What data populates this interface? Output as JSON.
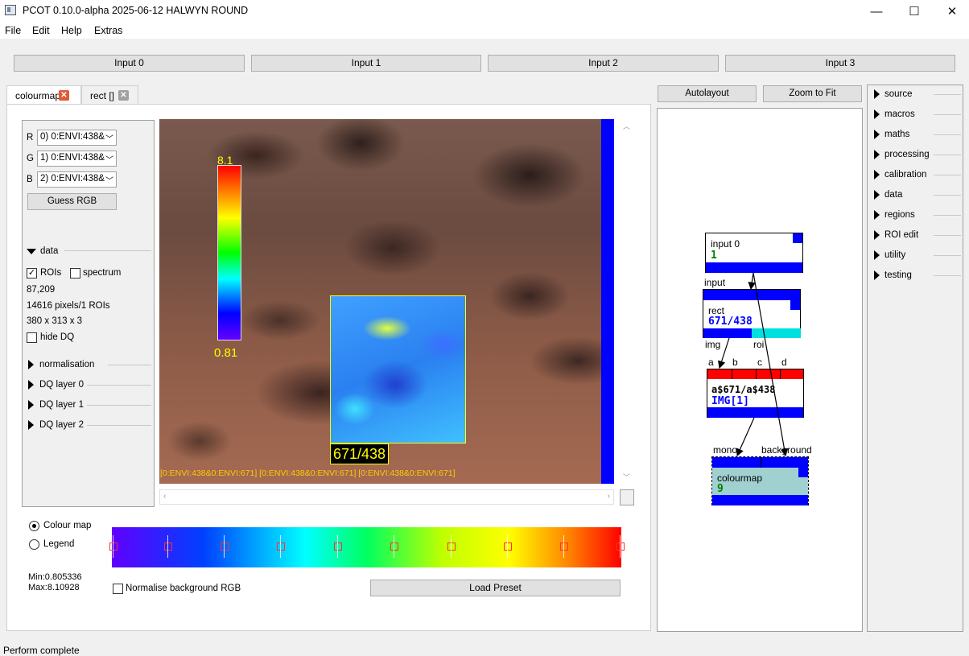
{
  "window": {
    "title": "PCOT 0.10.0-alpha 2025-06-12 HALWYN ROUND",
    "minimize": "—",
    "maximize": "☐",
    "close": "✕"
  },
  "menu": [
    "File",
    "Edit",
    "Help",
    "Extras"
  ],
  "inputs": [
    "Input 0",
    "Input 1",
    "Input 2",
    "Input 3"
  ],
  "tabs": [
    {
      "label": "colourmap",
      "active": true,
      "close_color": "#e05a3a"
    },
    {
      "label": "rect []",
      "active": false,
      "close_color": "#a0a0a0"
    }
  ],
  "controls": {
    "r_label": "R",
    "g_label": "G",
    "b_label": "B",
    "r_value": "0) 0:ENVI:438&",
    "g_value": "1) 0:ENVI:438&",
    "b_value": "2) 0:ENVI:438&",
    "guess_rgb": "Guess RGB",
    "data_section": "data",
    "rois_label": "ROIs",
    "rois_checked": true,
    "spectrum_label": "spectrum",
    "spectrum_checked": false,
    "coords": "87,209",
    "pixels": "14616 pixels/1 ROIs",
    "dims": "380 x 313 x 3",
    "hide_dq": "hide DQ",
    "sections": [
      "normalisation",
      "DQ layer 0",
      "DQ layer 1",
      "DQ layer 2"
    ]
  },
  "canvas": {
    "legend_max": "8.1",
    "legend_min": "0.81",
    "roi_label": "671/438",
    "caption": "[0:ENVI:438&0:ENVI:671] [0:ENVI:438&0:ENVI:671] [0:ENVI:438&0:ENVI:671]"
  },
  "colourbar": {
    "colour_map": "Colour map",
    "legend": "Legend",
    "mode": "Colour map",
    "min": "Min:0.805336",
    "max": "Max:8.10928",
    "normalise": "Normalise background RGB",
    "normalise_checked": false,
    "load_preset": "Load Preset"
  },
  "graph": {
    "autolayout": "Autolayout",
    "zoom_fit": "Zoom to Fit",
    "nodes": {
      "input0": {
        "title": "input 0",
        "value": "1"
      },
      "rect": {
        "title": "rect",
        "value": "671/438"
      },
      "expr": {
        "title": "a$671/a$438",
        "value": "IMG[1]"
      },
      "colourmap": {
        "title": "colourmap",
        "value": "9"
      }
    },
    "labels": {
      "input": "input",
      "img": "img",
      "roi": "roi",
      "a": "a",
      "b": "b",
      "c": "c",
      "d": "d",
      "mono": "mono",
      "background": "background"
    }
  },
  "palette": [
    "source",
    "macros",
    "maths",
    "processing",
    "calibration",
    "data",
    "regions",
    "ROI edit",
    "utility",
    "testing"
  ],
  "status": "Perform complete"
}
